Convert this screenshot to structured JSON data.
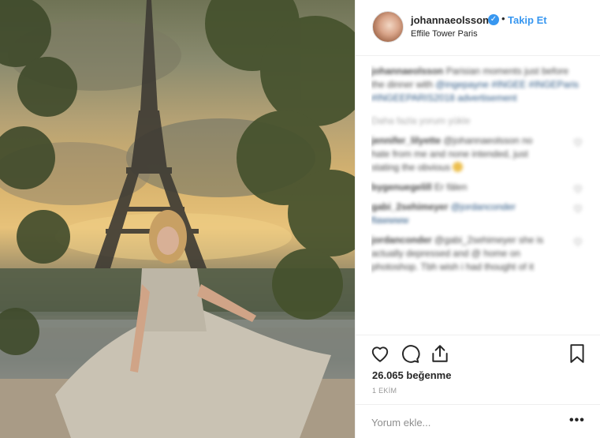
{
  "post": {
    "image_alt": "Woman in pleated metallic dress sitting by the Seine with the Eiffel Tower behind"
  },
  "header": {
    "username": "johannaeolsson",
    "verified_icon": "verified-badge-icon",
    "separator": "•",
    "follow_label": "Takip Et",
    "location": "Effile Tower Paris"
  },
  "comments": {
    "caption_user": "johannaeolsson",
    "caption_text": "Parisian moments just before the dinner with",
    "caption_tags": "@ingepayne #INGEE #INGEParis #INGEEPARIS2018 advertisement",
    "more_replies": "Daha fazla yorum yükle",
    "items": [
      {
        "user": "jennifer_lilyette",
        "text": "@johannaeolsson no hate from me and none intended, just stating the obvious"
      },
      {
        "user": "bygenuegelill",
        "text": "Er fälen"
      },
      {
        "user": "gabi_2sehimeyer",
        "text": "@jordanconder flawwww"
      },
      {
        "user": "jordanconder",
        "text": "@gabi_2sehimeyer she is actually depressed and @ home on photoshop. Tbh wish i had thought of it"
      }
    ]
  },
  "actions": {
    "like_icon": "heart-icon",
    "comment_icon": "comment-icon",
    "share_icon": "share-icon",
    "save_icon": "bookmark-icon"
  },
  "likes_text": "26.065 beğenme",
  "date": "1 EKİM",
  "add_comment": {
    "placeholder": "Yorum ekle...",
    "more_label": "•••"
  },
  "colors": {
    "accent": "#3897f0",
    "text": "#262626",
    "muted": "#999999",
    "border": "#efefef"
  }
}
